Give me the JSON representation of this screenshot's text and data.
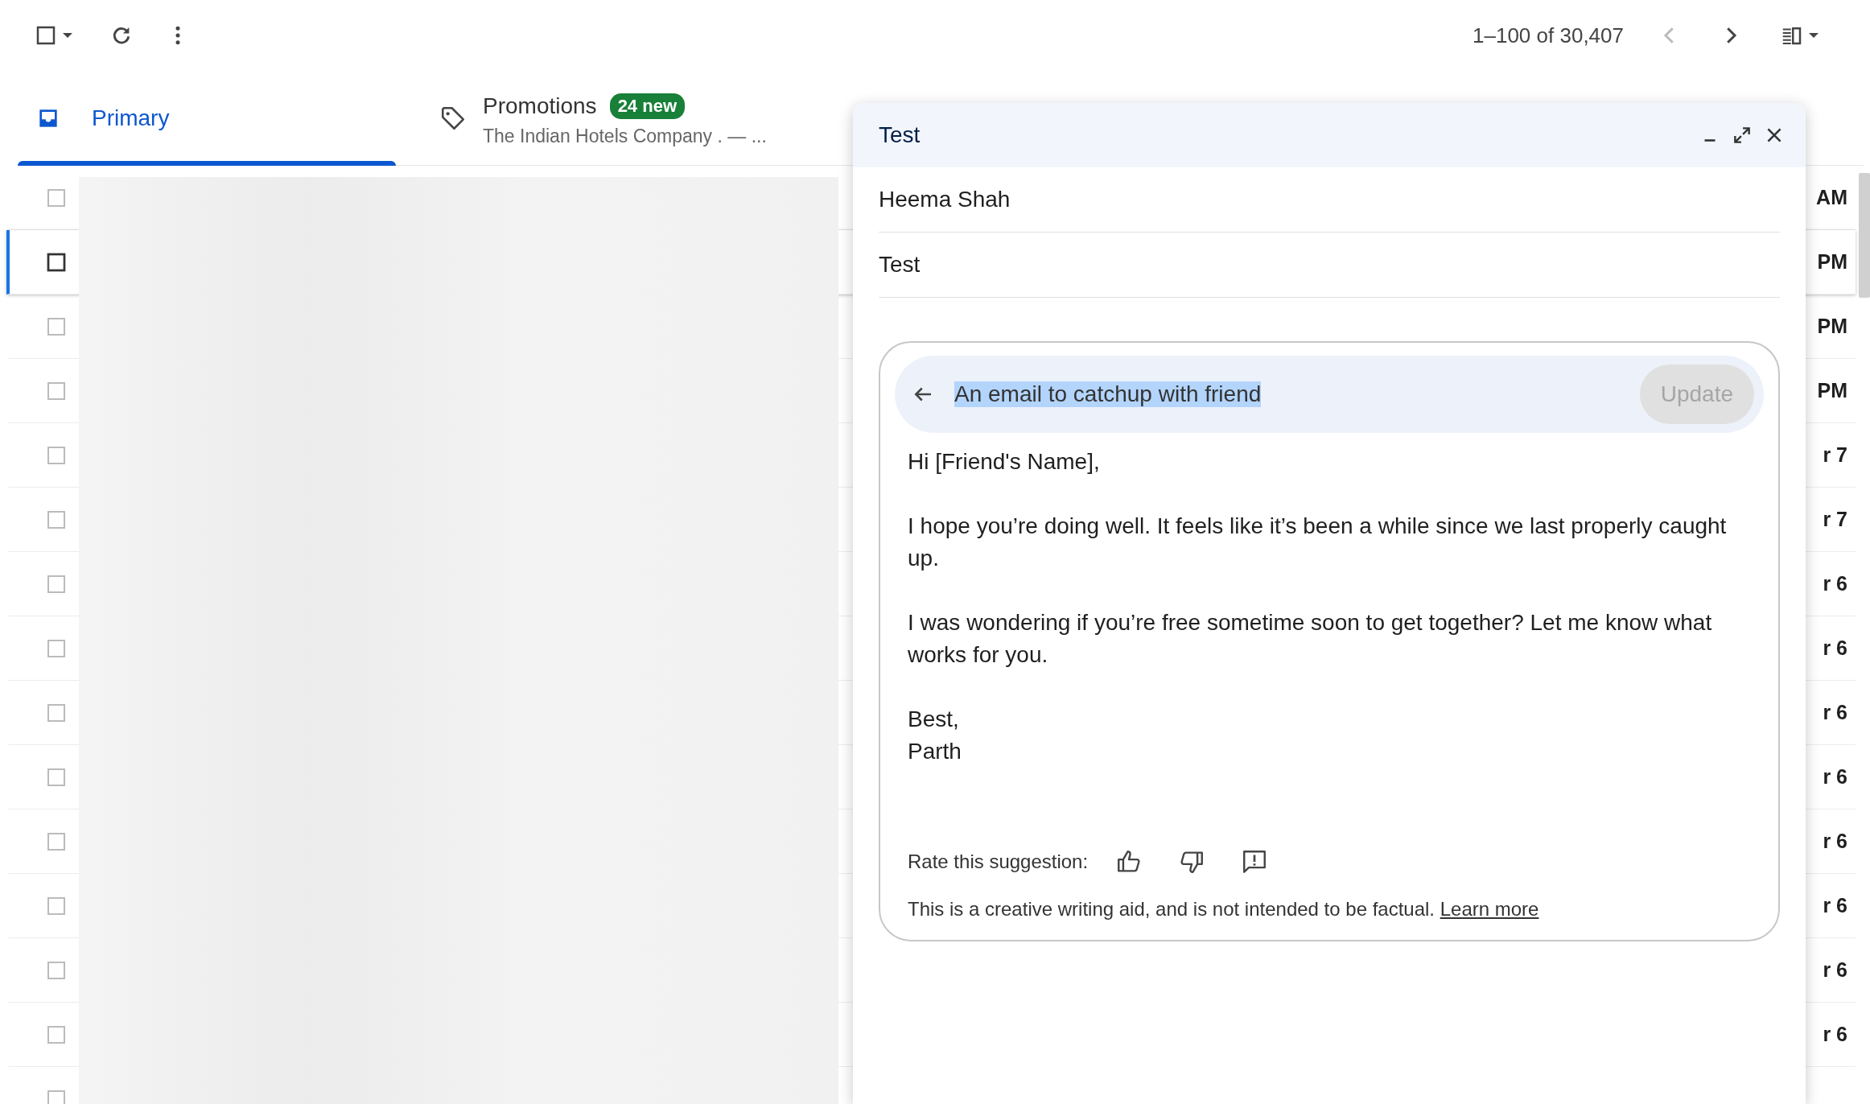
{
  "toolbar": {
    "range": "1–100 of 30,407",
    "prev_disabled": true,
    "select_all_checked": false
  },
  "tabs": [
    {
      "kind": "inbox",
      "label": "Primary",
      "selected": true
    },
    {
      "kind": "tag",
      "label": "Promotions",
      "selected": false,
      "badge": "24 new",
      "snippet": "The Indian Hotels Company . — ..."
    }
  ],
  "rows": [
    {
      "date": "AM",
      "selected": false
    },
    {
      "date": "PM",
      "selected": true
    },
    {
      "date": "PM",
      "selected": false
    },
    {
      "date": "PM",
      "selected": false
    },
    {
      "date": "r 7",
      "selected": false
    },
    {
      "date": "r 7",
      "selected": false
    },
    {
      "date": "r 6",
      "selected": false
    },
    {
      "date": "r 6",
      "selected": false
    },
    {
      "date": "r 6",
      "selected": false
    },
    {
      "date": "r 6",
      "selected": false
    },
    {
      "date": "r 6",
      "selected": false
    },
    {
      "date": "r 6",
      "selected": false
    },
    {
      "date": "r 6",
      "selected": false
    },
    {
      "date": "r 6",
      "selected": false
    },
    {
      "selected": false
    }
  ],
  "compose": {
    "title": "Test",
    "to": "Heema Shah",
    "subject": "Test",
    "assistant": {
      "prompt": "An email to catchup with friend",
      "update_button": "Update",
      "update_disabled": true,
      "paragraphs": [
        [
          "Hi [Friend's Name],"
        ],
        [
          "I hope you’re doing well. It feels like it’s been a while since we last properly caught up."
        ],
        [
          "I was wondering if you’re free sometime soon to get together? Let me know what works for you."
        ],
        [
          "Best,",
          "Parth"
        ]
      ],
      "rate_label": "Rate this suggestion:",
      "disclaimer": "This is a creative writing aid, and is not intended to be factual.",
      "learn_more": "Learn more"
    }
  }
}
